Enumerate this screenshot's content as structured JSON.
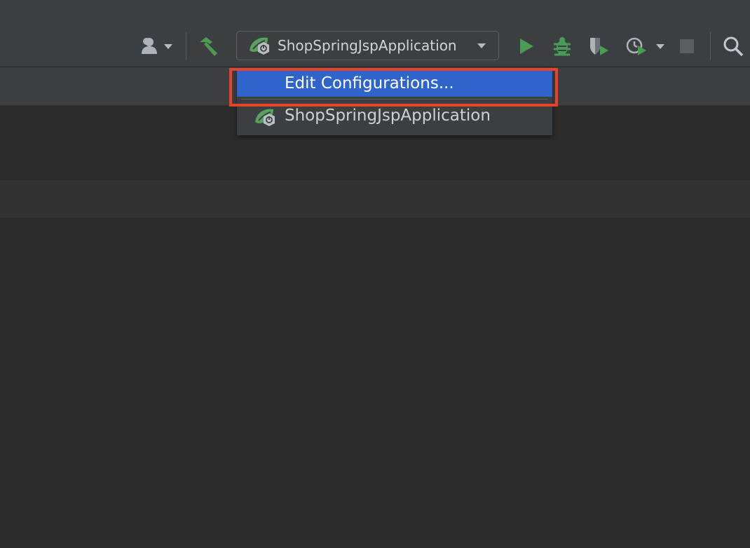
{
  "toolbar": {
    "run_config_label": "ShopSpringJspApplication",
    "icons": {
      "user": "user-icon",
      "build": "hammer-icon",
      "run": "run-icon",
      "debug": "debug-icon",
      "coverage": "coverage-icon",
      "profile": "profiler-icon",
      "stop": "stop-icon",
      "search": "search-icon"
    }
  },
  "run_config_menu": {
    "items": [
      {
        "label": "Edit Configurations...",
        "selected": true
      },
      {
        "label": "ShopSpringJspApplication",
        "selected": false
      }
    ]
  },
  "colors": {
    "accent_selected": "#2f65ca",
    "run_green": "#499c54",
    "highlight_red": "#e8432a"
  }
}
